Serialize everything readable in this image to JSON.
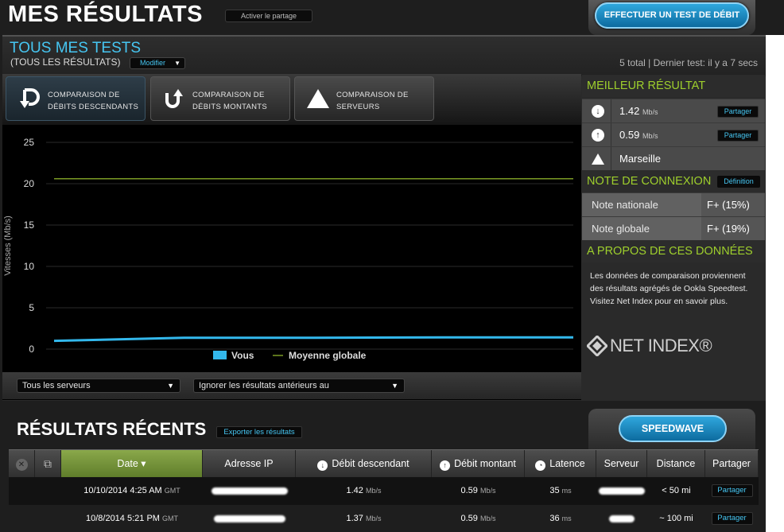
{
  "header": {
    "title": "MES RÉSULTATS",
    "share_toggle": "Activer le partage",
    "test_button": "EFFECTUER UN TEST DE DÉBIT"
  },
  "tests": {
    "title": "TOUS MES TESTS",
    "subtitle": "(TOUS LES RÉSULTATS)",
    "modify": "Modifier",
    "summary": "5 total | Dernier test: il y a 7 secs"
  },
  "compare": [
    {
      "line1": "COMPARAISON DE",
      "line2": "DÉBITS DESCENDANTS",
      "icon": "download-arrow-icon"
    },
    {
      "line1": "COMPARAISON DE",
      "line2": "DÉBITS MONTANTS",
      "icon": "upload-arrow-icon"
    },
    {
      "line1": "COMPARAISON DE",
      "line2": "SERVEURS",
      "icon": "server-triangle-icon"
    }
  ],
  "chart_data": {
    "type": "line",
    "ylabel": "Vitesses (Mb/s)",
    "yticks": [
      "0",
      "5",
      "10",
      "15",
      "20",
      "25"
    ],
    "ylim": [
      0,
      25
    ],
    "grid": true,
    "legend_position": "bottom-center",
    "series": [
      {
        "name": "Vous",
        "color": "#33b8ec",
        "values": [
          1.0,
          1.37,
          1.37,
          1.42,
          1.42
        ]
      },
      {
        "name": "Moyenne globale",
        "color": "#7a9a24",
        "values": [
          20.6,
          20.6,
          20.6,
          20.6,
          20.6
        ]
      }
    ]
  },
  "filters": {
    "servers": "Tous les serveurs",
    "ignore": "Ignorer les résultats antérieurs au"
  },
  "sidebar": {
    "best_title": "MEILLEUR RÉSULTAT",
    "best": [
      {
        "icon": "download-icon",
        "value": "1.42",
        "unit": "Mb/s",
        "share": "Partager"
      },
      {
        "icon": "upload-icon",
        "value": "0.59",
        "unit": "Mb/s",
        "share": "Partager"
      },
      {
        "icon": "server-icon",
        "value": "Marseille"
      }
    ],
    "note_title": "NOTE DE CONNEXION",
    "definition": "Définition",
    "notes": [
      {
        "label": "Note nationale",
        "value": "F+ (15%)"
      },
      {
        "label": "Note globale",
        "value": "F+ (19%)"
      }
    ],
    "about_title": "A PROPOS DE CES DONNÉES",
    "about_text": "Les données de comparaison proviennent des résultats agrégés de Ookla Speedtest. Visitez Net Index pour en savoir plus.",
    "logo_text": "NET INDEX®"
  },
  "recent": {
    "title": "RÉSULTATS RÉCENTS",
    "export": "Exporter les résultats",
    "speedwave": "SPEEDWAVE",
    "columns": [
      "Date ▾",
      "Adresse IP",
      "Débit descendant",
      "Débit montant",
      "Latence",
      "Serveur",
      "Distance",
      "Partager"
    ],
    "rows": [
      {
        "date": "10/10/2014 4:25 AM",
        "tz": "GMT",
        "down": "1.42",
        "down_unit": "Mb/s",
        "up": "0.59",
        "up_unit": "Mb/s",
        "latency": "35",
        "lat_unit": "ms",
        "distance": "< 50 mi",
        "share": "Partager"
      },
      {
        "date": "10/8/2014 5:21 PM",
        "tz": "GMT",
        "down": "1.37",
        "down_unit": "Mb/s",
        "up": "0.59",
        "up_unit": "Mb/s",
        "latency": "36",
        "lat_unit": "ms",
        "distance": "~ 100 mi",
        "share": "Partager"
      }
    ]
  }
}
